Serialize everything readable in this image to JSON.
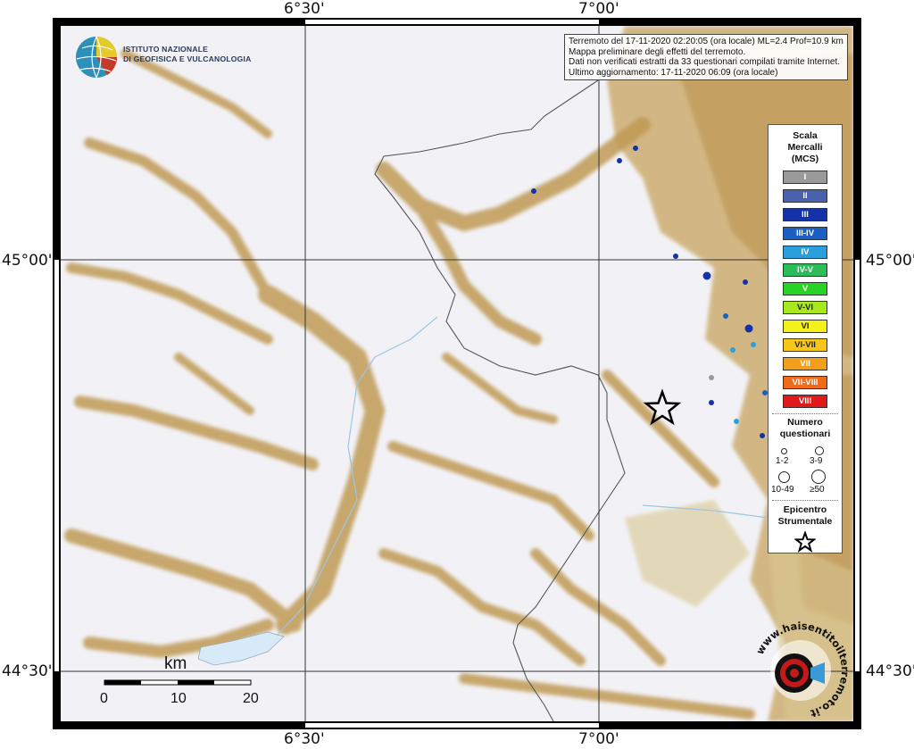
{
  "map": {
    "lon_labels": [
      "6°30'",
      "7°00'"
    ],
    "lat_labels": [
      "45°00'",
      "44°30'"
    ],
    "epicenter_icon": "star-icon"
  },
  "info": {
    "line1": "Terremoto del 17-11-2020 02:20:05 (ora locale) ML=2.4 Prof=10.9 km",
    "line2": "Mappa preliminare degli effetti del terremoto.",
    "line3": "Dati non verificati estratti da 33 questionari compilati tramite Internet.",
    "line4": "Ultimo aggiornamento: 17-11-2020 06:09 (ora locale)"
  },
  "logo": {
    "line1": "ISTITUTO NAZIONALE",
    "line2": "DI GEOFISICA E VULCANOLOGIA"
  },
  "legend": {
    "scale_title_1": "Scala",
    "scale_title_2": "Mercalli",
    "scale_title_3": "(MCS)",
    "mcs": [
      {
        "label": "I",
        "color": "#9a9a9a"
      },
      {
        "label": "II",
        "color": "#4a62ad"
      },
      {
        "label": "III",
        "color": "#1433a8"
      },
      {
        "label": "III-IV",
        "color": "#1b5fc4"
      },
      {
        "label": "IV",
        "color": "#2a9fdc"
      },
      {
        "label": "IV-V",
        "color": "#2bbd5a"
      },
      {
        "label": "V",
        "color": "#27d327"
      },
      {
        "label": "V-VI",
        "color": "#a7e81f"
      },
      {
        "label": "VI",
        "color": "#f4f01c"
      },
      {
        "label": "VI-VII",
        "color": "#f7c61a"
      },
      {
        "label": "VII",
        "color": "#f49f1c"
      },
      {
        "label": "VII-VIII",
        "color": "#f06a1a"
      },
      {
        "label": "VIII",
        "color": "#e01a1a"
      }
    ],
    "num_title_1": "Numero",
    "num_title_2": "questionari",
    "size_1": "1-2",
    "size_2": "3-9",
    "size_3": "10-49",
    "size_4": "≥50",
    "epi_title_1": "Epicentro",
    "epi_title_2": "Strumentale"
  },
  "scalebar": {
    "unit": "km",
    "ticks": [
      "0",
      "10",
      "20"
    ]
  },
  "badge": {
    "text": "www.haisentitoilterremoto.it"
  }
}
